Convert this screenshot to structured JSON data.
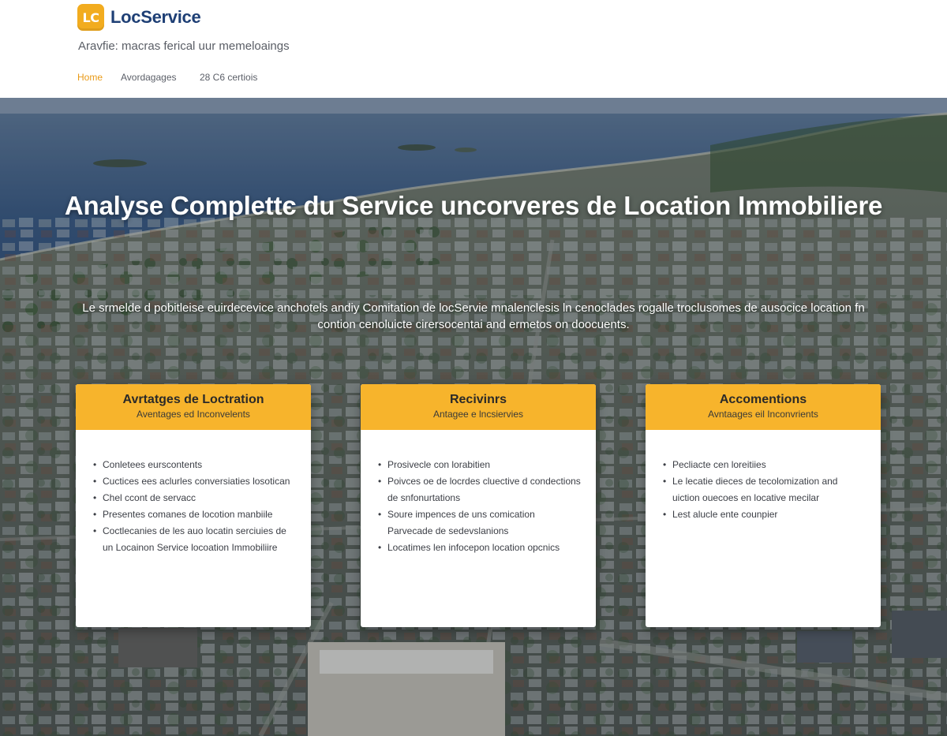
{
  "brand": {
    "logo_text": "LC",
    "name": "LocService",
    "tagline": "Aravfie: macras ferical uur memeloaings",
    "accent_color": "#f2ac1f",
    "name_color": "#1e3f75"
  },
  "nav": {
    "items": [
      {
        "label": "Home",
        "active": true
      },
      {
        "label": "Avordagages",
        "active": false
      },
      {
        "label": "28 C6 certiois",
        "active": false
      }
    ]
  },
  "hero": {
    "title": "Analyse Complettє du Service uncorveres de Location Immobiliere",
    "subtitle": "Le srmelde d pobitleise euirdecevice anchotels andiy Comitation de locServie mnalenclesis ln cenoclades rogalle troclusomes de ausocice location fn contion cenoluicte cirersocentai and ermetos on doocuents."
  },
  "cards": [
    {
      "title": "Avrtatges de Loctration",
      "subtitle": "Aventages ed Inconvelents",
      "items": [
        "Conletees eurscontents",
        "Cuctices ees aclurles conversiaties losotican",
        "Chel ccont de servacc",
        "Presentes comanes de locotion manbiile",
        "Coctlecanies de les auo locatin serciuies de un Locainon Service locoation Immobiliire"
      ]
    },
    {
      "title": "Recivinrs",
      "subtitle": "Antagee e lncsiervies",
      "items": [
        "Prosivecle con lorabitien",
        "Poivces oe de locrdes cluective d condections de snfonurtations",
        "Soure impences de uns comication Parvecade de sedevslanions",
        "Locatimes len infocepon location opcnics"
      ]
    },
    {
      "title": "Accomentions",
      "subtitle": "Avntaages eil Inconvrients",
      "items": [
        "Pecliacte cen loreitiies",
        "Le lecatie dieces de tecolomization and uiction ouecoes en locative mecilar",
        "Lest alucle ente counpier"
      ]
    }
  ]
}
